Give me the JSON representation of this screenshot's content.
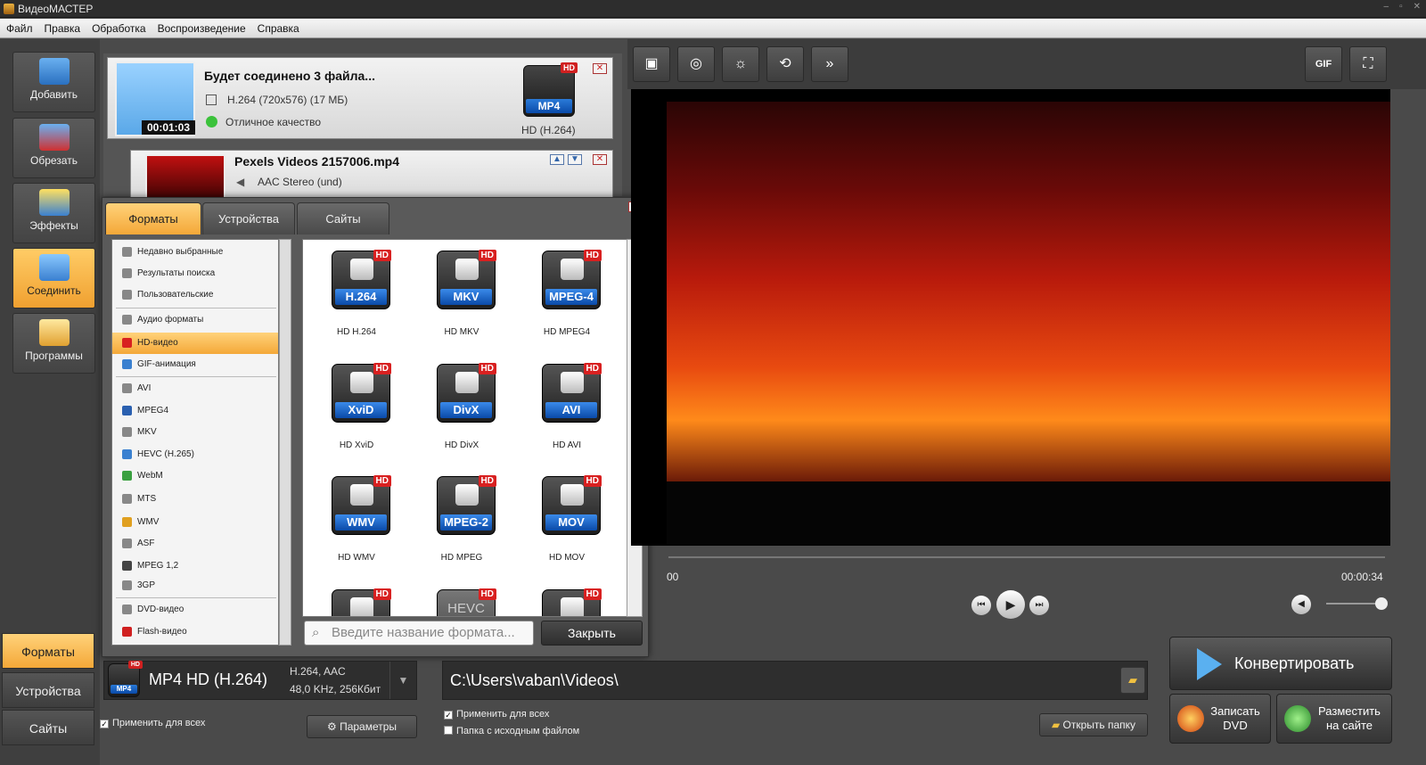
{
  "window": {
    "title": "ВидеоМАСТЕР"
  },
  "menu": [
    "Файл",
    "Правка",
    "Обработка",
    "Воспроизведение",
    "Справка"
  ],
  "sidebar": {
    "items": [
      {
        "label": "Добавить",
        "icon": "add-video-icon"
      },
      {
        "label": "Обрезать",
        "icon": "scissors-icon"
      },
      {
        "label": "Эффекты",
        "icon": "magic-wand-icon"
      },
      {
        "label": "Соединить",
        "icon": "join-icon",
        "active": true
      },
      {
        "label": "Программы",
        "icon": "programs-icon"
      }
    ],
    "bottom_tabs": [
      {
        "label": "Форматы",
        "active": true
      },
      {
        "label": "Устройства"
      },
      {
        "label": "Сайты"
      }
    ]
  },
  "files": {
    "merged": {
      "title": "Будет соединено 3 файла...",
      "codec": "H.264 (720x576) (17 МБ)",
      "quality": "Отличное качество",
      "duration": "00:01:03",
      "format_badge": "MP4",
      "format_caption": "HD (H.264)"
    },
    "item2": {
      "title": "Pexels Videos 2157006.mp4",
      "audio": "AAC Stereo (und)"
    }
  },
  "dialog": {
    "tabs": [
      {
        "label": "Форматы",
        "active": true
      },
      {
        "label": "Устройства"
      },
      {
        "label": "Сайты"
      }
    ],
    "categories": [
      {
        "label": "Недавно выбранные",
        "icon": "recent-icon"
      },
      {
        "label": "Результаты поиска",
        "icon": "search-results-icon"
      },
      {
        "label": "Пользовательские",
        "icon": "user-icon"
      },
      {
        "label": "Аудио форматы",
        "icon": "music-note-icon"
      },
      {
        "label": "HD-видео",
        "icon": "hd-icon",
        "active": true
      },
      {
        "label": "GIF-анимация",
        "icon": "gif-icon"
      },
      {
        "label": "AVI",
        "icon": "avi-icon"
      },
      {
        "label": "MPEG4",
        "icon": "mp4-icon"
      },
      {
        "label": "MKV",
        "icon": "mkv-icon"
      },
      {
        "label": "HEVC (H.265)",
        "icon": "hevc-icon"
      },
      {
        "label": "WebM",
        "icon": "webm-icon"
      },
      {
        "label": "MTS",
        "icon": "mts-icon"
      },
      {
        "label": "WMV",
        "icon": "wmv-icon"
      },
      {
        "label": "ASF",
        "icon": "asf-icon"
      },
      {
        "label": "MPEG 1,2",
        "icon": "mpeg-icon"
      },
      {
        "label": "3GP",
        "icon": "phone-icon"
      },
      {
        "label": "DVD-видео",
        "icon": "dvd-icon"
      },
      {
        "label": "Flash-видео",
        "icon": "flash-icon"
      }
    ],
    "formats": [
      {
        "badge": "H.264",
        "caption": "HD H.264"
      },
      {
        "badge": "MKV",
        "caption": "HD MKV"
      },
      {
        "badge": "MPEG-4",
        "caption": "HD MPEG4"
      },
      {
        "badge": "XviD",
        "caption": "HD XviD"
      },
      {
        "badge": "DivX",
        "caption": "HD DivX"
      },
      {
        "badge": "AVI",
        "caption": "HD AVI"
      },
      {
        "badge": "WMV",
        "caption": "HD WMV"
      },
      {
        "badge": "MPEG-2",
        "caption": "HD MPEG"
      },
      {
        "badge": "MOV",
        "caption": "HD MOV"
      }
    ],
    "partial_row": [
      "",
      "HEVC",
      ""
    ],
    "search_placeholder": "Введите название формата...",
    "close_label": "Закрыть"
  },
  "player": {
    "time_start": "00",
    "time_end": "00:00:34",
    "toolbar": [
      "crop-icon",
      "stabilize-icon",
      "brightness-icon",
      "rotate-icon",
      "speed-icon"
    ],
    "gif_label": "GIF",
    "volume_level": 0.9
  },
  "output": {
    "format_name": "MP4 HD (H.264)",
    "format_badge": "MP4",
    "codec_line1": "H.264, AAC",
    "codec_line2": "48,0 KHz, 256Кбит",
    "apply_all": "Применить для всех",
    "params": "Параметры",
    "path": "C:\\Users\\vaban\\Videos\\",
    "apply_all_right": "Применить для всех",
    "source_folder": "Папка с исходным файлом",
    "open_folder": "Открыть папку"
  },
  "actions": {
    "convert": "Конвертировать",
    "dvd": [
      "Записать",
      "DVD"
    ],
    "upload": [
      "Разместить",
      "на сайте"
    ]
  },
  "colors": {
    "accent": "#f4a838",
    "hd_red": "#d82020",
    "badge_blue": "#0a4aa8"
  }
}
